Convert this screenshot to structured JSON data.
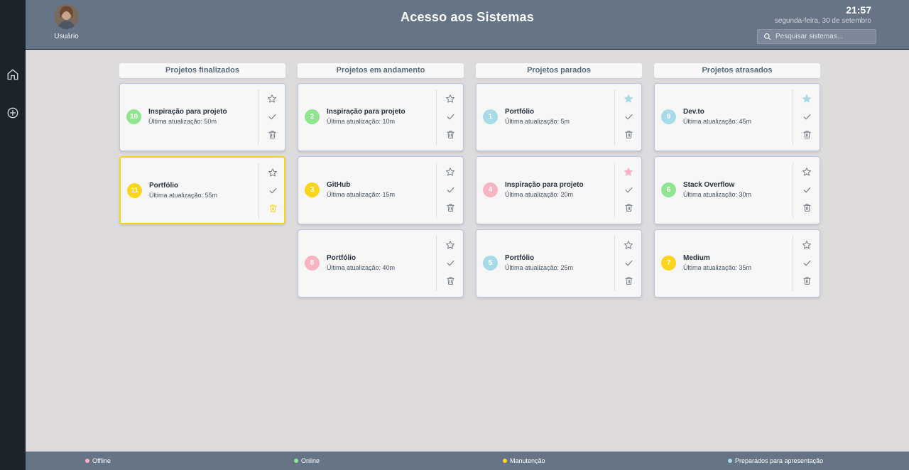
{
  "colors": {
    "green": "#90e591",
    "yellow": "#fdd61b",
    "blue": "#a8dbe8",
    "pink": "#f8b4c2",
    "star_outline": "#6f7780",
    "star_blue": "#a8dbe8",
    "star_pink": "#f8b4c2"
  },
  "header": {
    "title": "Acesso aos Sistemas",
    "user_label": "Usuário",
    "time": "21:57",
    "date": "segunda-feira, 30 de setembro",
    "search_placeholder": "Pesquisar sistemas..."
  },
  "sidebar": {
    "icons": [
      "home-icon",
      "add-circle-icon"
    ]
  },
  "columns": [
    {
      "title": "Projetos finalizados",
      "cards": [
        {
          "number": "10",
          "color": "green",
          "title": "Inspiração para projeto",
          "subtitle": "Última atualização: 50m",
          "star": "outline"
        },
        {
          "number": "11",
          "color": "yellow",
          "title": "Portfólio",
          "subtitle": "Última atualização: 55m",
          "star": "outline",
          "selected": true
        }
      ]
    },
    {
      "title": "Projetos em andamento",
      "cards": [
        {
          "number": "2",
          "color": "green",
          "title": "Inspiração para projeto",
          "subtitle": "Última atualização: 10m",
          "star": "outline"
        },
        {
          "number": "3",
          "color": "yellow",
          "title": "GitHub",
          "subtitle": "Última atualização: 15m",
          "star": "outline"
        },
        {
          "number": "8",
          "color": "pink",
          "title": "Portfólio",
          "subtitle": "Última atualização: 40m",
          "star": "outline"
        }
      ]
    },
    {
      "title": "Projetos parados",
      "cards": [
        {
          "number": "1",
          "color": "blue",
          "title": "Portfólio",
          "subtitle": "Última atualização: 5m",
          "star": "filled-blue"
        },
        {
          "number": "4",
          "color": "pink",
          "title": "Inspiração para projeto",
          "subtitle": "Última atualização: 20m",
          "star": "filled-pink"
        },
        {
          "number": "5",
          "color": "blue",
          "title": "Portfólio",
          "subtitle": "Última atualização: 25m",
          "star": "outline"
        }
      ]
    },
    {
      "title": "Projetos atrasados",
      "cards": [
        {
          "number": "9",
          "color": "blue",
          "title": "Dev.to",
          "subtitle": "Última atualização: 45m",
          "star": "filled-blue"
        },
        {
          "number": "6",
          "color": "green",
          "title": "Stack Overflow",
          "subtitle": "Última atualização: 30m",
          "star": "outline"
        },
        {
          "number": "7",
          "color": "yellow",
          "title": "Medium",
          "subtitle": "Última atualização: 35m",
          "star": "outline"
        }
      ]
    }
  ],
  "legend": [
    {
      "label": "Offline",
      "color": "pink"
    },
    {
      "label": "Online",
      "color": "green"
    },
    {
      "label": "Manutenção",
      "color": "yellow"
    },
    {
      "label": "Preparados para apresentação",
      "color": "blue"
    }
  ]
}
